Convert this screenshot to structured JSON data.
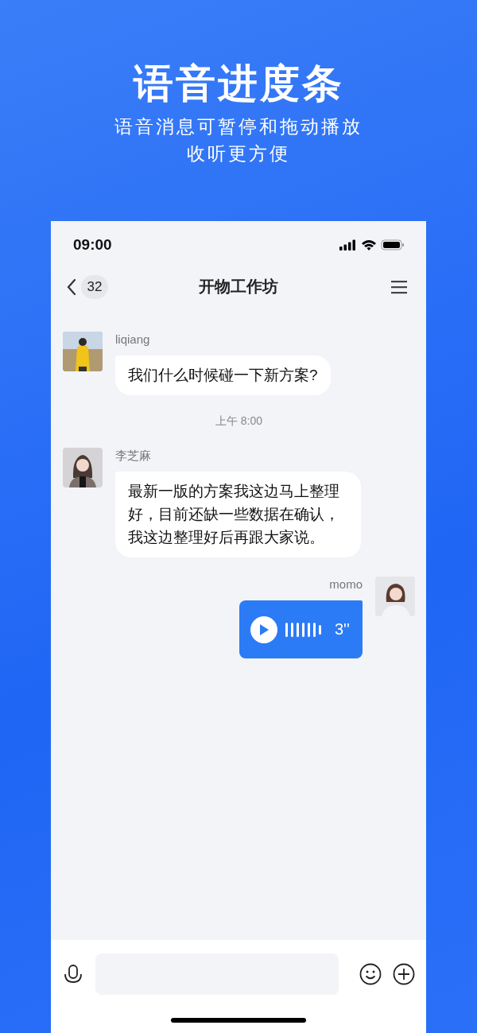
{
  "headline": "语音进度条",
  "subtitle": [
    "语音消息可暂停和拖动播放",
    "收听更方便"
  ],
  "phone": {
    "status_bar": {
      "time": "09:00"
    },
    "header": {
      "back_count": "32",
      "title": "开物工作坊"
    },
    "messages": [
      {
        "kind": "text",
        "outgoing": false,
        "sender": "liqiang",
        "text": "我们什么时候碰一下新方案?"
      },
      {
        "kind": "time",
        "text": "上午 8:00"
      },
      {
        "kind": "text",
        "outgoing": false,
        "sender": "李芝麻",
        "text": "最新一版的方案我这边马上整理好，目前还缺一些数据在确认，我这边整理好后再跟大家说。"
      },
      {
        "kind": "voice",
        "outgoing": true,
        "sender": "momo",
        "duration": "3''"
      }
    ]
  }
}
